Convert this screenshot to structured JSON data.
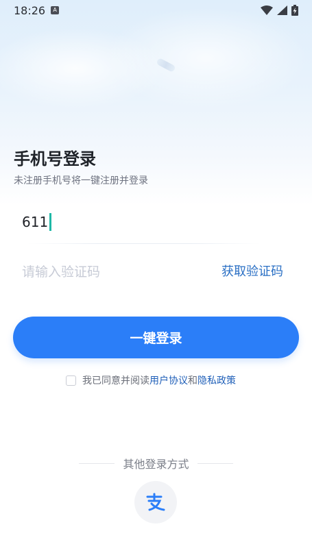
{
  "status_bar": {
    "time": "18:26",
    "notification_icon": "a-letter-icon",
    "icons": [
      "wifi-icon",
      "signal-icon",
      "battery-charging-icon"
    ]
  },
  "page": {
    "title": "手机号登录",
    "subtitle": "未注册手机号将一键注册并登录"
  },
  "form": {
    "phone_value": "611",
    "code_placeholder": "请输入验证码",
    "get_code_label": "获取验证码",
    "login_label": "一键登录"
  },
  "agreement": {
    "checked": false,
    "prefix": "我已同意并阅读",
    "user_agreement": "用户协议",
    "and": "和",
    "privacy_policy": "隐私政策"
  },
  "other_login": {
    "label": "其他登录方式",
    "methods": [
      "alipay-icon"
    ]
  },
  "colors": {
    "primary": "#2b7ef8",
    "link": "#1f5fb8",
    "cursor": "#1fb8a6"
  }
}
